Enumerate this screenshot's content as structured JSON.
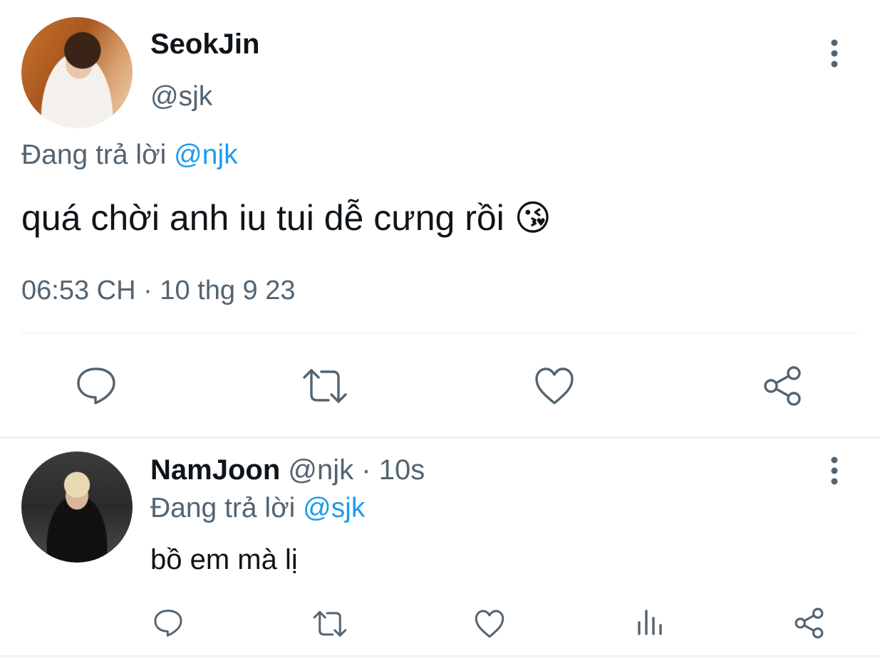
{
  "tweet": {
    "display_name": "SeokJin",
    "handle": "@sjk",
    "replying_prefix": "Đang trả lời",
    "replying_to": "@njk",
    "text": "quá chời anh iu tui dễ cưng rồi",
    "emoji": "😘",
    "timestamp": "06:53 CH · 10 thg 9 23",
    "actions": [
      "reply-icon",
      "retweet-icon",
      "like-icon",
      "share-icon"
    ]
  },
  "reply": {
    "display_name": "NamJoon",
    "handle": "@njk",
    "separator": "·",
    "time": "10s",
    "replying_prefix": "Đang trả lời",
    "replying_to": "@sjk",
    "text": "bồ em mà lị",
    "actions": [
      "reply-icon",
      "retweet-icon",
      "like-icon",
      "views-icon",
      "share-icon"
    ]
  },
  "colors": {
    "text": "#0f1419",
    "secondary": "#536471",
    "link": "#1d9bf0",
    "divider": "#eff3f4"
  }
}
